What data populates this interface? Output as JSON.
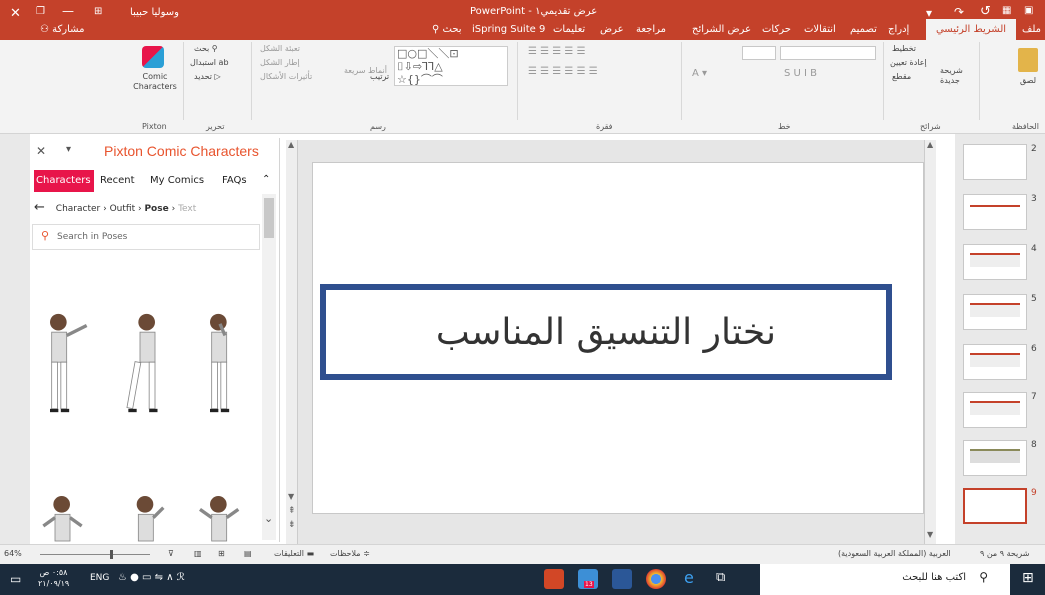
{
  "titlebar": {
    "app": "PowerPoint",
    "doc": "عرض تقديمي١",
    "separator": "-",
    "user": "وسوليا حبيبا",
    "share": "مشاركة"
  },
  "tabs": [
    "ملف",
    "الشريط الرئيسي",
    "إدراج",
    "تصميم",
    "انتقالات",
    "حركات",
    "عرض الشرائح",
    "مراجعة",
    "عرض",
    "تعليمات",
    "iSpring Suite 9",
    "بحث"
  ],
  "ribbon": {
    "pixton": {
      "button": "Comic Characters",
      "group": "Pixton"
    },
    "editing": {
      "find": "بحث",
      "replace": "استبدال",
      "select": "تحديد",
      "group": "تحرير"
    },
    "drawing": {
      "fill": "تعبئة الشكل",
      "outline": "إطار الشكل",
      "effects": "تأثيرات الأشكال",
      "arrange": "ترتيب",
      "styles": "أنماط سريعة",
      "group": "رسم"
    },
    "paragraph": {
      "group": "فقرة"
    },
    "font": {
      "group": "خط",
      "decoration": "S U I B"
    },
    "slides": {
      "layout": "تخطيط",
      "reset": "إعادة تعيين",
      "new": "شريحة جديدة",
      "section": "مقطع",
      "group": "شرائح"
    },
    "clipboard": {
      "paste": "لصق",
      "group": "الحافظة"
    }
  },
  "pixton": {
    "title": "Pixton Comic Characters",
    "tabs": [
      "Characters",
      "Recent",
      "My Comics",
      "FAQs"
    ],
    "crumbs": {
      "c1": "Character",
      "c2": "Outfit",
      "c3": "Pose",
      "c4": "Text",
      "sep": "›"
    },
    "search_placeholder": "Search in Poses"
  },
  "slide": {
    "text": "نختار التنسيق المناسب"
  },
  "thumbnails": [
    "2",
    "3",
    "4",
    "5",
    "6",
    "7",
    "8",
    "9"
  ],
  "status": {
    "slide": "شريحة ٩ من ٩",
    "language": "العربية (المملكة العربية السعودية)",
    "notes": "ملاحظات",
    "comments": "التعليقات",
    "zoom": "64%"
  },
  "taskbar": {
    "search": "اكتب هنا للبحث",
    "lang": "ENG",
    "time": "٠:٥٨ ص",
    "date": "٢١/٠٩/١٩",
    "badge": "13"
  },
  "colors": {
    "accent": "#c4412a",
    "slide_border": "#2f4f8f",
    "pixton": "#e8542e",
    "tab_active": "#e8154a"
  },
  "icons": [
    "search-icon",
    "share-icon",
    "close-icon",
    "undo-icon",
    "redo-icon",
    "windows-icon"
  ]
}
